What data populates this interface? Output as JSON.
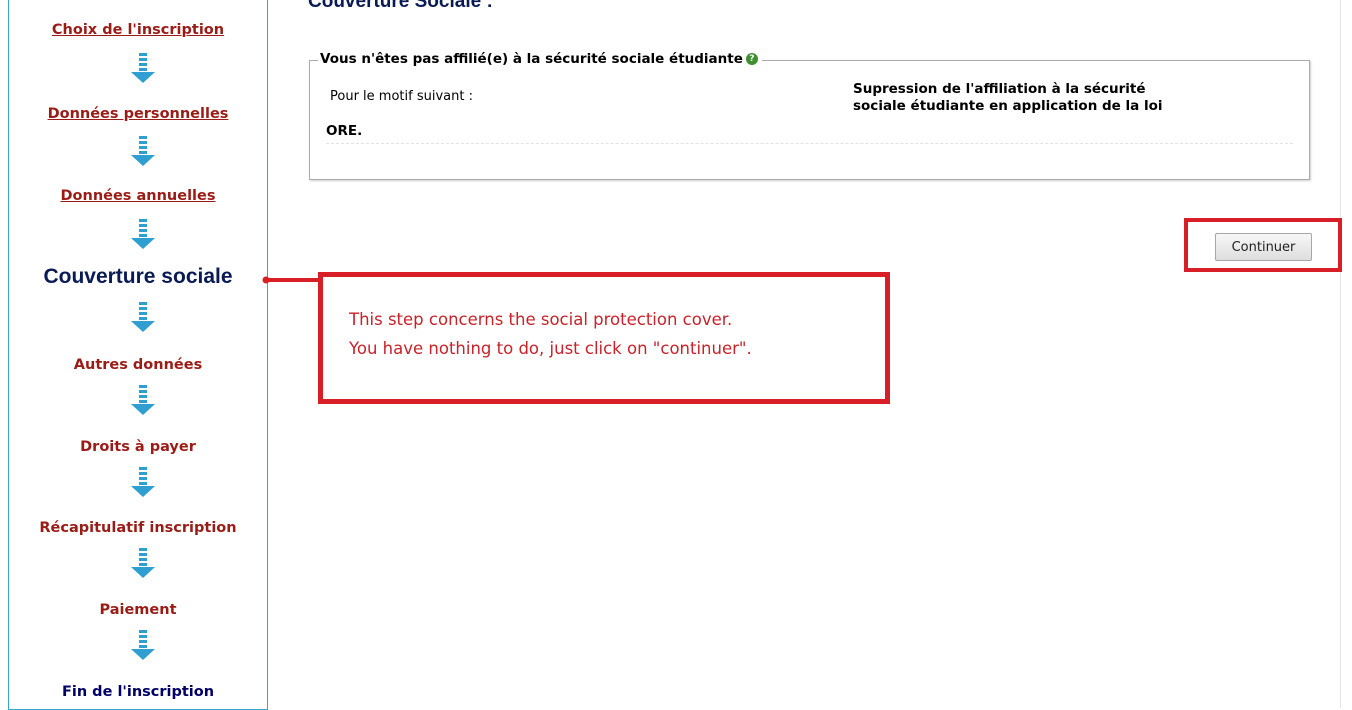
{
  "sidebar": {
    "steps": [
      {
        "label": "Choix de l'inscription",
        "state": "done"
      },
      {
        "label": "Données personnelles",
        "state": "done"
      },
      {
        "label": "Données annuelles",
        "state": "done"
      },
      {
        "label": "Couverture sociale",
        "state": "current"
      },
      {
        "label": "Autres données",
        "state": "todo"
      },
      {
        "label": "Droits à payer",
        "state": "todo"
      },
      {
        "label": "Récapitulatif inscription",
        "state": "todo"
      },
      {
        "label": "Paiement",
        "state": "todo"
      },
      {
        "label": "Fin de l'inscription",
        "state": "todo"
      }
    ],
    "arrow_icon": "down-arrow-icon",
    "colors": {
      "done": "#9b1c16",
      "current": "#0a1a55",
      "arrow": "#2e9fd0",
      "border": "#39a4cc"
    }
  },
  "main": {
    "title": "Couverture Sociale :",
    "fieldset": {
      "legend": "Vous n'êtes pas affilié(e) à la sécurité sociale étudiante",
      "help_icon": "help-icon",
      "label": "Pour le motif suivant :",
      "value_line1": "Supression de l'affiliation à la sécurité",
      "value_line2": "sociale étudiante en application de la loi",
      "value_line3": "ORE."
    },
    "continue_button": "Continuer"
  },
  "annotation": {
    "line1": "This step concerns the social protection cover.",
    "line2": "You have nothing to do, just click on \"continuer\".",
    "color": "#d81e27"
  }
}
